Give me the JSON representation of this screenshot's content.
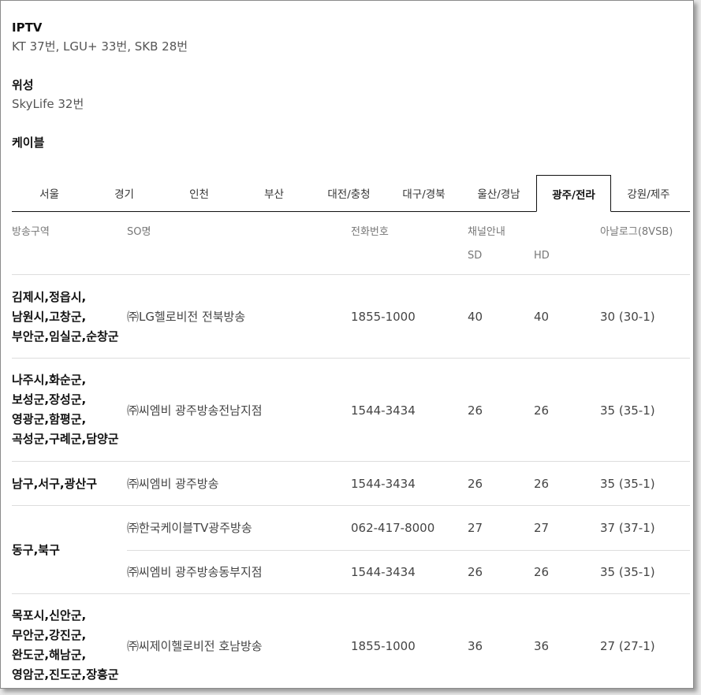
{
  "sections": [
    {
      "title": "IPTV",
      "value": "KT 37번, LGU+ 33번, SKB 28번"
    },
    {
      "title": "위성",
      "value": "SkyLife 32번"
    },
    {
      "title": "케이블",
      "value": ""
    }
  ],
  "tabs": [
    "서울",
    "경기",
    "인천",
    "부산",
    "대전/충청",
    "대구/경북",
    "울산/경남",
    "광주/전라",
    "강원/제주"
  ],
  "active_tab": "광주/전라",
  "table": {
    "headers": {
      "region": "방송구역",
      "so": "SO명",
      "phone": "전화번호",
      "channel": "채널안내",
      "sd": "SD",
      "hd": "HD",
      "analog": "아날로그(8VSB)"
    },
    "rows": [
      {
        "region": "김제시,정읍시,남원시,고창군,부안군,임실군,순창군",
        "entries": [
          {
            "so": "㈜LG헬로비전 전북방송",
            "phone": "1855-1000",
            "sd": "40",
            "hd": "40",
            "analog": "30 (30-1)"
          }
        ]
      },
      {
        "region": "나주시,화순군,보성군,장성군,영광군,함평군,곡성군,구례군,담양군",
        "entries": [
          {
            "so": "㈜씨엠비 광주방송전남지점",
            "phone": "1544-3434",
            "sd": "26",
            "hd": "26",
            "analog": "35 (35-1)"
          }
        ]
      },
      {
        "region": "남구,서구,광산구",
        "entries": [
          {
            "so": "㈜씨엠비 광주방송",
            "phone": "1544-3434",
            "sd": "26",
            "hd": "26",
            "analog": "35 (35-1)"
          }
        ]
      },
      {
        "region": "동구,북구",
        "entries": [
          {
            "so": "㈜한국케이블TV광주방송",
            "phone": "062-417-8000",
            "sd": "27",
            "hd": "27",
            "analog": "37 (37-1)"
          },
          {
            "so": "㈜씨엠비 광주방송동부지점",
            "phone": "1544-3434",
            "sd": "26",
            "hd": "26",
            "analog": "35 (35-1)"
          }
        ]
      },
      {
        "region": "목포시,신안군,무안군,강진군,완도군,해남군,영암군,진도군,장흥군",
        "entries": [
          {
            "so": "㈜씨제이헬로비전 호남방송",
            "phone": "1855-1000",
            "sd": "36",
            "hd": "36",
            "analog": "27 (27-1)"
          }
        ]
      }
    ]
  }
}
